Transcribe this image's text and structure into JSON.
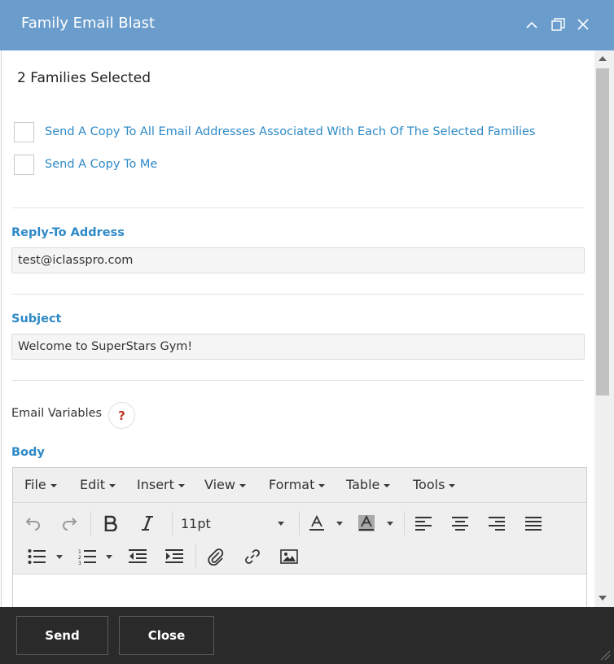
{
  "window": {
    "title": "Family Email Blast"
  },
  "selection": {
    "families_text": "2 Families Selected"
  },
  "options": [
    {
      "label": "Send A Copy To All Email Addresses Associated With Each Of The Selected Families",
      "checked": false
    },
    {
      "label": "Send A Copy To Me",
      "checked": false
    }
  ],
  "reply_to": {
    "label": "Reply-To Address",
    "value": "test@iclasspro.com"
  },
  "subject": {
    "label": "Subject",
    "value": "Welcome to SuperStars Gym!"
  },
  "email_variables": {
    "label": "Email Variables",
    "help_symbol": "?"
  },
  "body": {
    "label": "Body",
    "menu": [
      "File",
      "Edit",
      "Insert",
      "View",
      "Format",
      "Table",
      "Tools"
    ],
    "font_size": "11pt"
  },
  "footer": {
    "send_label": "Send",
    "close_label": "Close"
  },
  "colors": {
    "title_bar": "#6b9dcc",
    "accent": "#2e8ac7",
    "footer": "#2a2a2a"
  }
}
